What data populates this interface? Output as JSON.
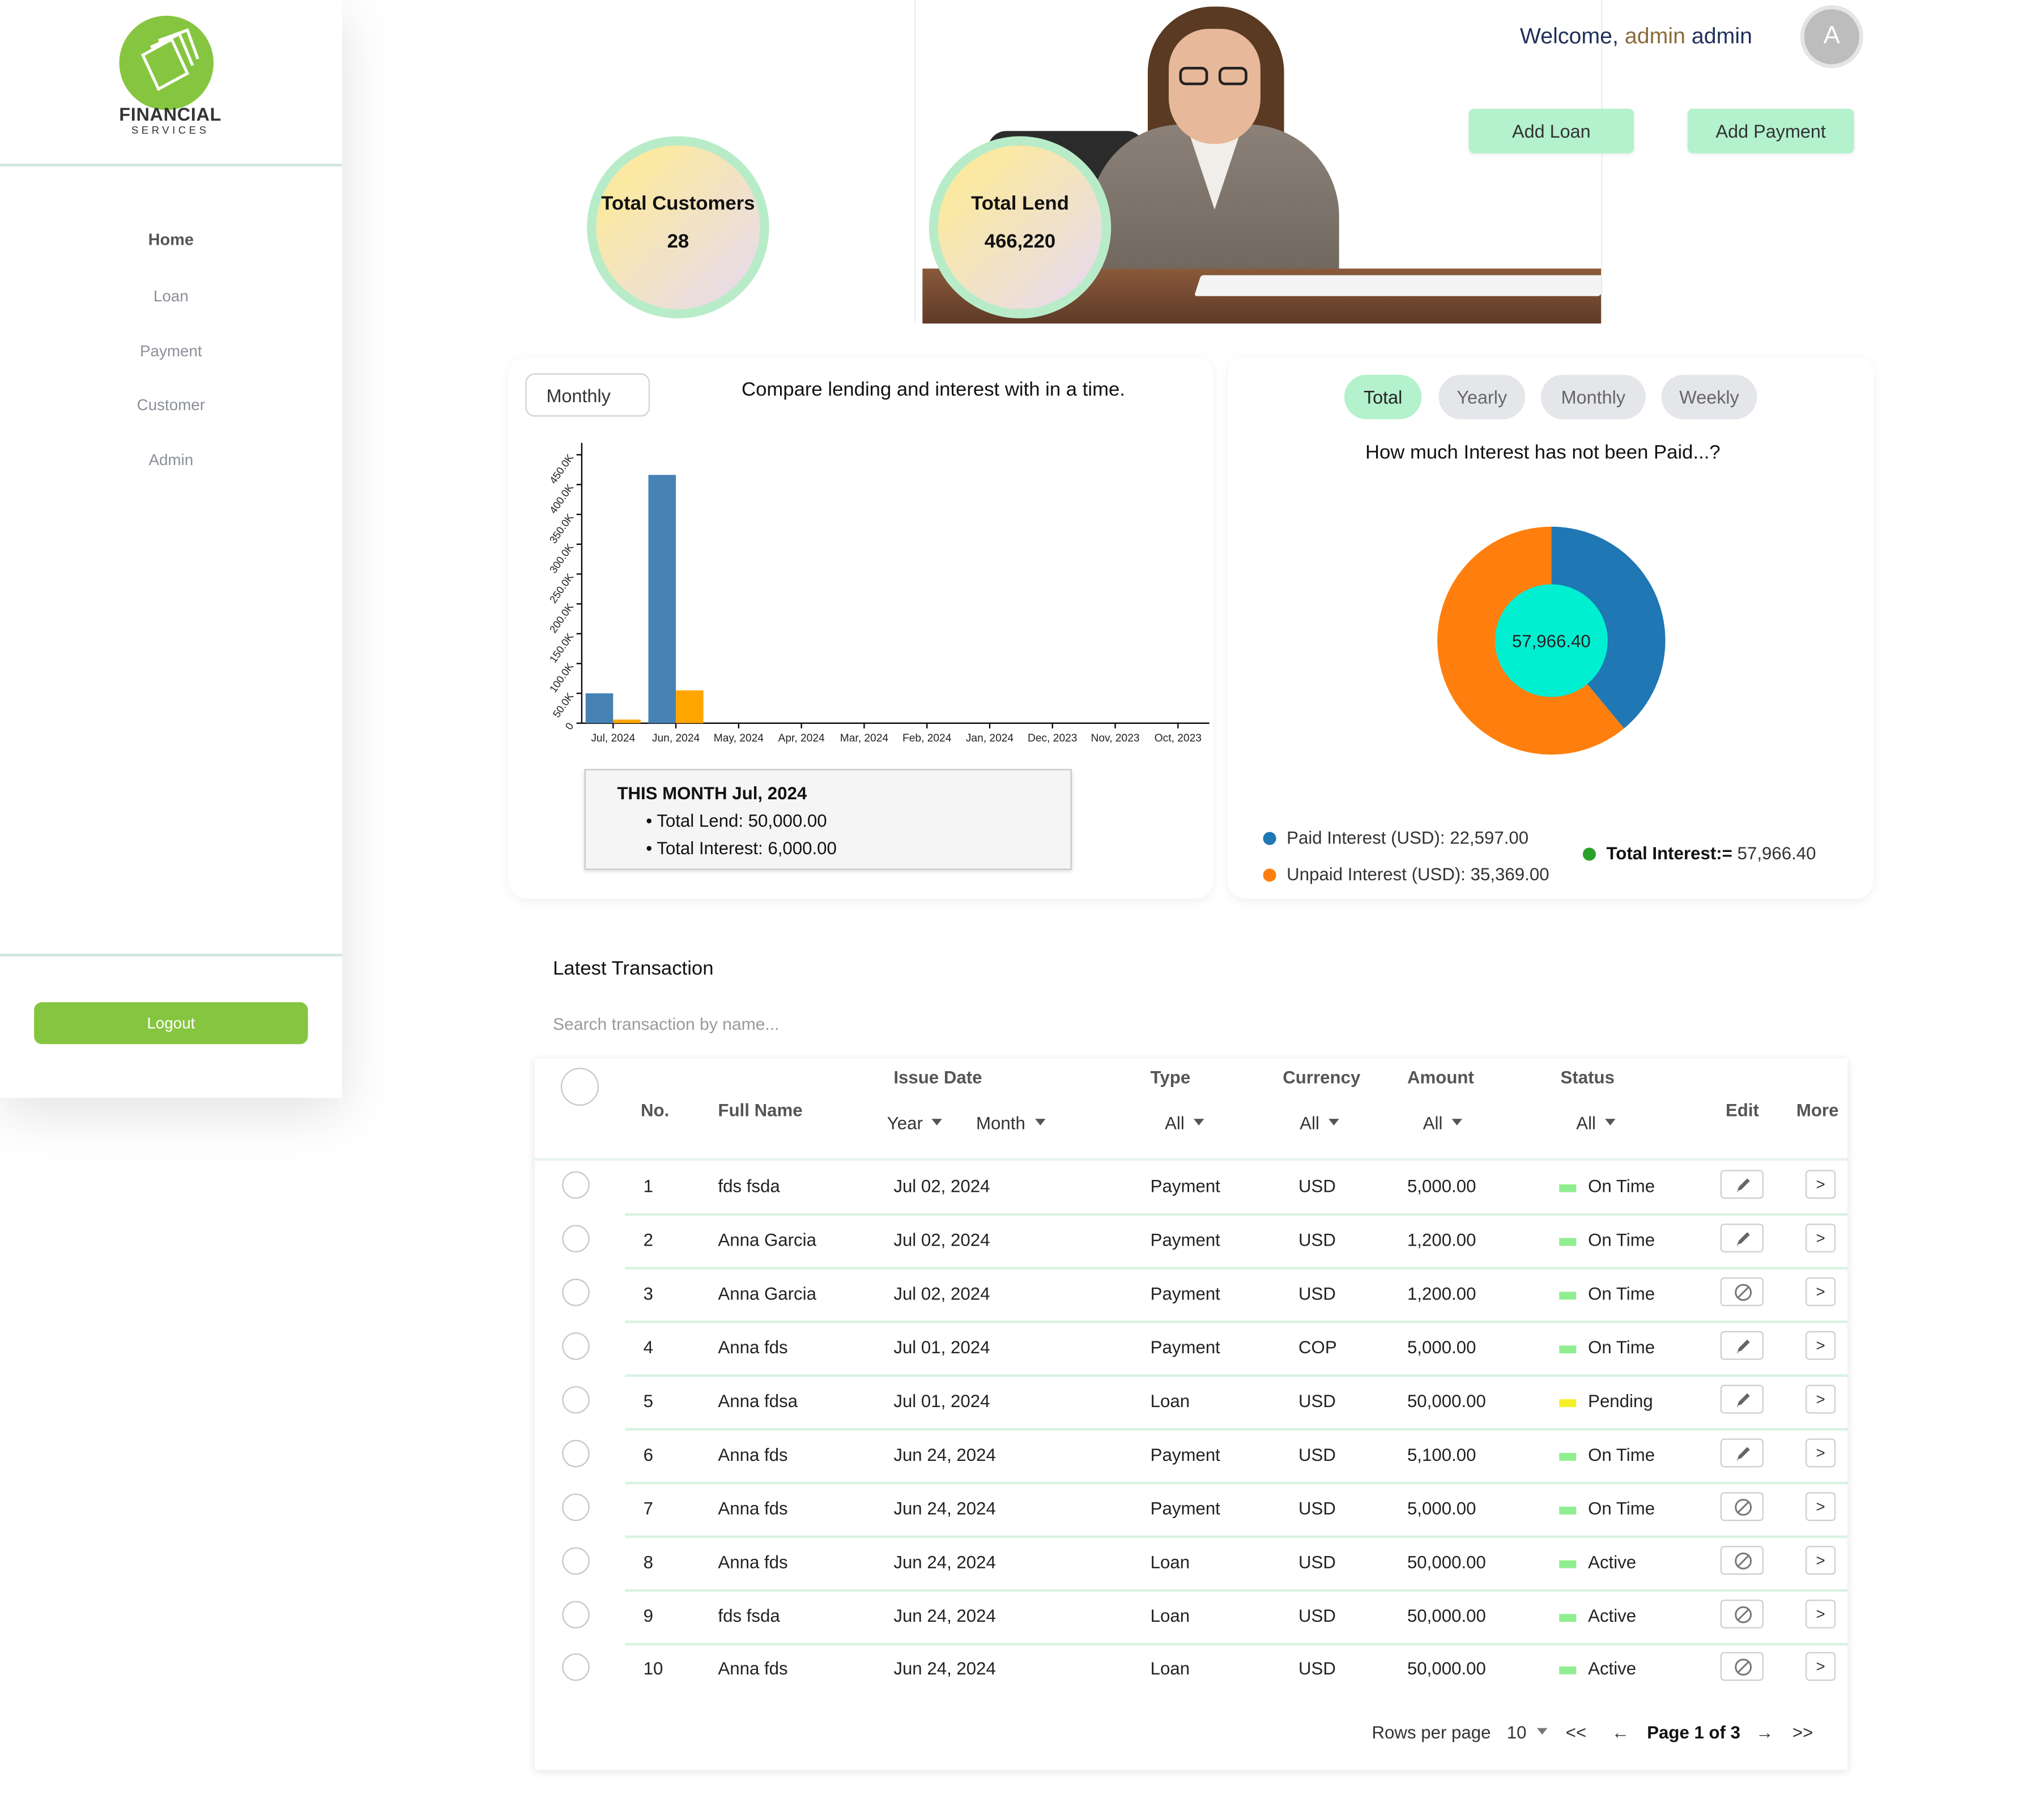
{
  "app": {
    "logo_text": "FINANCIAL",
    "logo_sub": "SERVICES"
  },
  "sidebar": {
    "items": [
      {
        "label": "Home",
        "active": true
      },
      {
        "label": "Loan",
        "active": false
      },
      {
        "label": "Payment",
        "active": false
      },
      {
        "label": "Customer",
        "active": false
      },
      {
        "label": "Admin",
        "active": false
      }
    ],
    "logout_label": "Logout"
  },
  "header": {
    "welcome_prefix": "Welcome,",
    "first_name": "admin",
    "last_name": "admin",
    "avatar_letter": "A",
    "add_loan_label": "Add Loan",
    "add_payment_label": "Add Payment"
  },
  "stats": {
    "customers_label": "Total Customers",
    "customers_value": "28",
    "lend_label": "Total Lend",
    "lend_value": "466,220"
  },
  "lending_chart": {
    "period_select": "Monthly",
    "title": "Compare lending and interest with in a time.",
    "tooltip_title": "THIS MONTH Jul, 2024",
    "tooltip_lend": "• Total Lend: 50,000.00",
    "tooltip_interest": "• Total Interest: 6,000.00"
  },
  "chart_data": [
    {
      "type": "bar",
      "title": "Compare lending and interest with in a time.",
      "categories": [
        "Jul, 2024",
        "Jun, 2024",
        "May, 2024",
        "Apr, 2024",
        "Mar, 2024",
        "Feb, 2024",
        "Jan, 2024",
        "Dec, 2023",
        "Nov, 2023",
        "Oct, 2023"
      ],
      "series": [
        {
          "values": [
            50000,
            416220,
            0,
            0,
            0,
            0,
            0,
            0,
            0,
            0
          ],
          "color": "#4682b4"
        },
        {
          "values": [
            6000,
            55000,
            0,
            0,
            0,
            0,
            0,
            0,
            0,
            0
          ],
          "color": "#ffa500"
        }
      ],
      "y_ticks": [
        "0",
        "50.0K",
        "100.0K",
        "150.0K",
        "200.0K",
        "250.0K",
        "300.0K",
        "350.0K",
        "400.0K",
        "450.0K"
      ],
      "ylim": [
        0,
        470000
      ]
    },
    {
      "type": "pie",
      "title": "How much Interest has not been Paid...?",
      "center_label": "57,966.40",
      "slices": [
        {
          "label": "Paid Interest (USD)",
          "value": 22597.0,
          "color": "#1f77b4"
        },
        {
          "label": "Unpaid Interest (USD)",
          "value": 35369.0,
          "color": "#ff7f0e"
        }
      ],
      "inner_color": "#00efd1"
    }
  ],
  "interest_panel": {
    "tabs": [
      "Total",
      "Yearly",
      "Monthly",
      "Weekly"
    ],
    "active_tab": "Total",
    "title": "How much Interest has not been Paid...?",
    "paid_label": "Paid Interest (USD): 22,597.00",
    "unpaid_label": "Unpaid Interest (USD): 35,369.00",
    "total_label": "Total Interest:=",
    "total_value": "57,966.40",
    "colors": {
      "paid": "#1f77b4",
      "unpaid": "#ff7f0e",
      "total": "#2ca02c"
    }
  },
  "transactions": {
    "title": "Latest Transaction",
    "search_placeholder": "Search transaction by name...",
    "headers": {
      "no": "No.",
      "full_name": "Full Name",
      "issue_date": "Issue Date",
      "type": "Type",
      "currency": "Currency",
      "amount": "Amount",
      "status": "Status",
      "edit": "Edit",
      "more": "More"
    },
    "filters": {
      "year": "Year",
      "month": "Month",
      "type": "All",
      "currency": "All",
      "amount": "All",
      "status": "All"
    },
    "rows": [
      {
        "no": "1",
        "name": "fds fsda",
        "date": "Jul 02, 2024",
        "type": "Payment",
        "currency": "USD",
        "amount": "5,000.00",
        "status": "On Time",
        "status_color": "#90ee90",
        "edit_icon": "pencil-icon"
      },
      {
        "no": "2",
        "name": "Anna Garcia",
        "date": "Jul 02, 2024",
        "type": "Payment",
        "currency": "USD",
        "amount": "1,200.00",
        "status": "On Time",
        "status_color": "#90ee90",
        "edit_icon": "pencil-icon"
      },
      {
        "no": "3",
        "name": "Anna Garcia",
        "date": "Jul 02, 2024",
        "type": "Payment",
        "currency": "USD",
        "amount": "1,200.00",
        "status": "On Time",
        "status_color": "#90ee90",
        "edit_icon": "disabled-icon"
      },
      {
        "no": "4",
        "name": "Anna fds",
        "date": "Jul 01, 2024",
        "type": "Payment",
        "currency": "COP",
        "amount": "5,000.00",
        "status": "On Time",
        "status_color": "#90ee90",
        "edit_icon": "pencil-icon"
      },
      {
        "no": "5",
        "name": "Anna fdsa",
        "date": "Jul 01, 2024",
        "type": "Loan",
        "currency": "USD",
        "amount": "50,000.00",
        "status": "Pending",
        "status_color": "#f5ef2a",
        "edit_icon": "pencil-icon"
      },
      {
        "no": "6",
        "name": "Anna fds",
        "date": "Jun 24, 2024",
        "type": "Payment",
        "currency": "USD",
        "amount": "5,100.00",
        "status": "On Time",
        "status_color": "#90ee90",
        "edit_icon": "pencil-icon"
      },
      {
        "no": "7",
        "name": "Anna fds",
        "date": "Jun 24, 2024",
        "type": "Payment",
        "currency": "USD",
        "amount": "5,000.00",
        "status": "On Time",
        "status_color": "#90ee90",
        "edit_icon": "disabled-icon"
      },
      {
        "no": "8",
        "name": "Anna fds",
        "date": "Jun 24, 2024",
        "type": "Loan",
        "currency": "USD",
        "amount": "50,000.00",
        "status": "Active",
        "status_color": "#90ee90",
        "edit_icon": "disabled-icon"
      },
      {
        "no": "9",
        "name": "fds fsda",
        "date": "Jun 24, 2024",
        "type": "Loan",
        "currency": "USD",
        "amount": "50,000.00",
        "status": "Active",
        "status_color": "#90ee90",
        "edit_icon": "disabled-icon"
      },
      {
        "no": "10",
        "name": "Anna fds",
        "date": "Jun 24, 2024",
        "type": "Loan",
        "currency": "USD",
        "amount": "50,000.00",
        "status": "Active",
        "status_color": "#90ee90",
        "edit_icon": "disabled-icon"
      }
    ],
    "more_label": ">",
    "pagination": {
      "rows_label": "Rows per page",
      "rows_value": "10",
      "first_label": "<<",
      "prev_label": "←",
      "page_label": "Page 1 of 3",
      "next_label": "→",
      "last_label": ">>"
    }
  }
}
